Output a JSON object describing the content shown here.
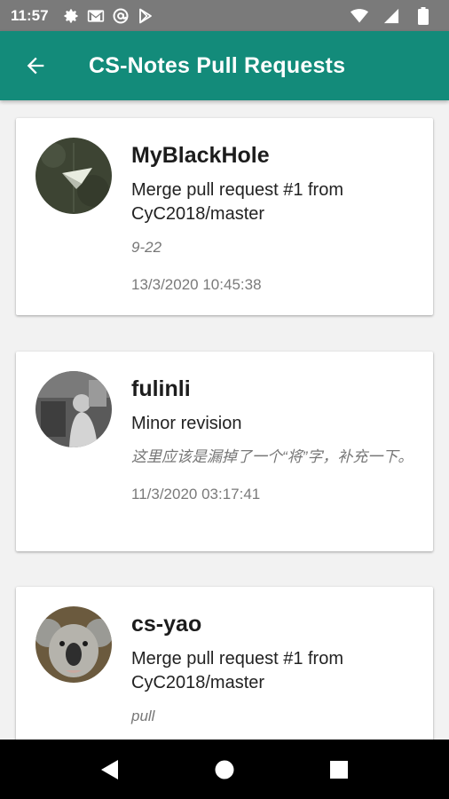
{
  "status_bar": {
    "time": "11:57",
    "left_icons": [
      "gear-icon",
      "gmail-icon",
      "at-sign-icon",
      "play-store-icon"
    ],
    "right_icons": [
      "wifi-icon",
      "signal-icon",
      "battery-icon"
    ],
    "background": "#7a7a7a"
  },
  "app_bar": {
    "title": "CS-Notes Pull Requests",
    "back_icon": "arrow-back-icon",
    "color": "#138b7a"
  },
  "pull_requests": [
    {
      "user": "MyBlackHole",
      "title": "Merge pull request #1 from CyC2018/master",
      "body": "9-22",
      "date": "13/3/2020 10:45:38"
    },
    {
      "user": "fulinli",
      "title": "Minor revision",
      "body": "这里应该是漏掉了一个“将”字，补充一下。",
      "date": "11/3/2020 03:17:41"
    },
    {
      "user": "cs-yao",
      "title": "Merge pull request #1 from CyC2018/master",
      "body": "pull",
      "date": ""
    }
  ],
  "nav_bar": {
    "icons": [
      "back-triangle-icon",
      "home-circle-icon",
      "recents-square-icon"
    ]
  }
}
